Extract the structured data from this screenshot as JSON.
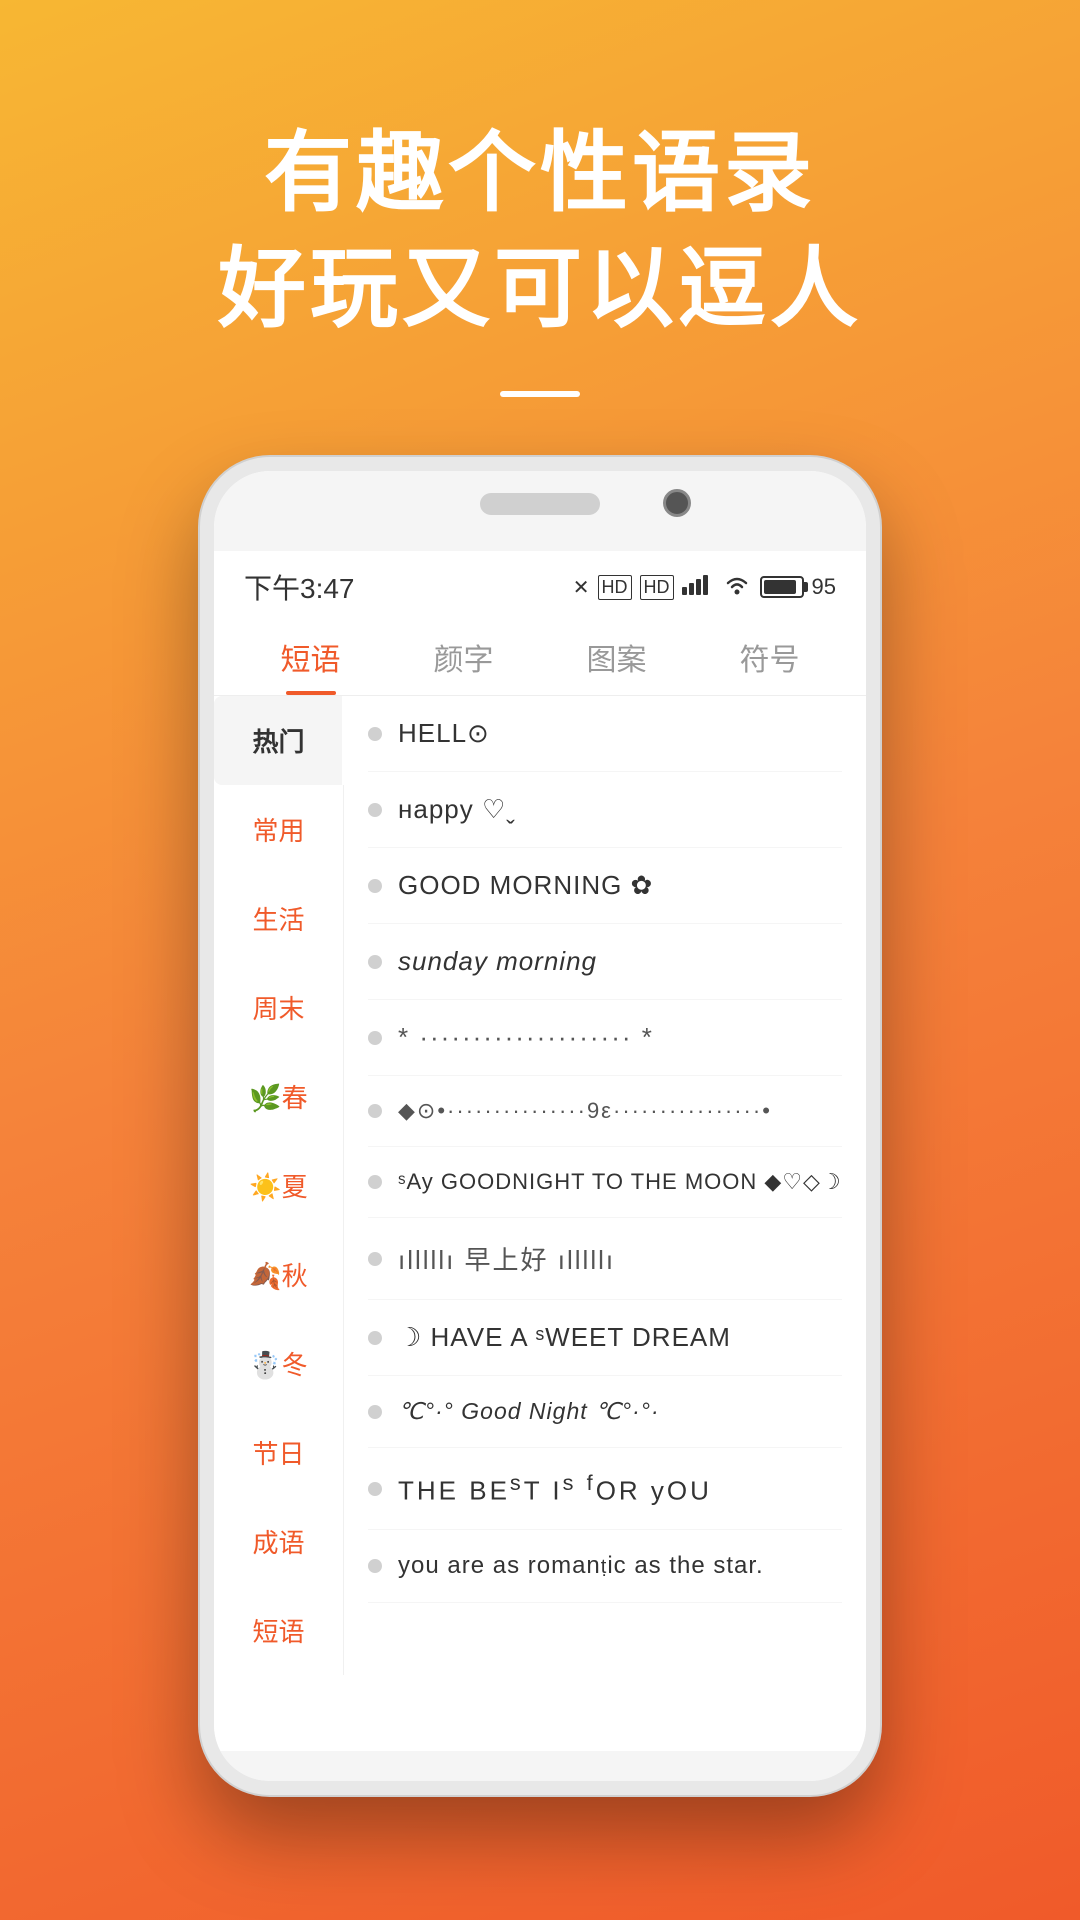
{
  "hero": {
    "title1": "有趣个性语录",
    "title2": "好玩又可以逗人"
  },
  "phone": {
    "status_time": "下午3:47",
    "battery_pct": "95",
    "tabs": [
      {
        "label": "短语",
        "active": true
      },
      {
        "label": "颜字",
        "active": false
      },
      {
        "label": "图案",
        "active": false
      },
      {
        "label": "符号",
        "active": false
      }
    ],
    "sidebar_items": [
      {
        "label": "热门",
        "active": true,
        "emoji": ""
      },
      {
        "label": "常用",
        "active": false,
        "emoji": ""
      },
      {
        "label": "生活",
        "active": false,
        "emoji": ""
      },
      {
        "label": "周末",
        "active": false,
        "emoji": ""
      },
      {
        "label": "🌿春",
        "active": false,
        "emoji": "🌿"
      },
      {
        "label": "☀️夏",
        "active": false,
        "emoji": "☀️"
      },
      {
        "label": "🍂秋",
        "active": false,
        "emoji": "🍂"
      },
      {
        "label": "☃️冬",
        "active": false,
        "emoji": "☃️"
      },
      {
        "label": "节日",
        "active": false,
        "emoji": ""
      },
      {
        "label": "成语",
        "active": false,
        "emoji": ""
      },
      {
        "label": "短语",
        "active": false,
        "emoji": ""
      }
    ],
    "list_items": [
      {
        "text": "HELL⊙"
      },
      {
        "text": "нappy ♡ˬ"
      },
      {
        "text": "GOOD MORNING ✿"
      },
      {
        "text": "sunday morning"
      },
      {
        "text": "* ---···---···---···--- *"
      },
      {
        "text": "◆ ⊙ • ·············9ε·············· •"
      },
      {
        "text": "ˢAy GOODNIGHT TO THE MOON ◆♡◇☽"
      },
      {
        "text": "ılllllı 早上好 ılllllı"
      },
      {
        "text": "☽ HAVE A ˢWEET DREAM"
      },
      {
        "text": "℃°·° Good Night ℃°·°·"
      },
      {
        "text": "THE BEST IS ᶠOR yOU"
      },
      {
        "text": "you are as romantic as the star."
      }
    ]
  }
}
